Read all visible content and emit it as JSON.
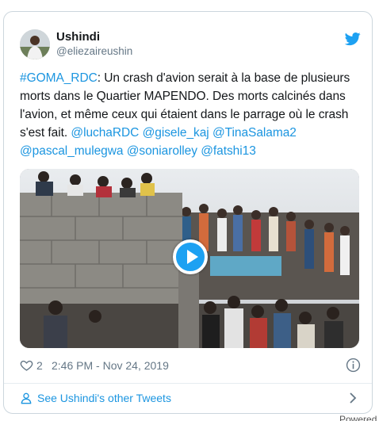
{
  "tweet": {
    "display_name": "Ushindi",
    "handle": "@eliezaireushin",
    "text_parts": [
      {
        "text": "#GOMA_RDC",
        "link": true
      },
      {
        "text": ": Un crash d'avion serait à la base de plusieurs morts dans le Quartier MAPENDO. Des morts calcinés dans l'avion, et même ceux qui étaient dans le parrage où le crash s'est fait. ",
        "link": false
      },
      {
        "text": "@luchaRDC",
        "link": true
      },
      {
        "text": " ",
        "link": false
      },
      {
        "text": "@gisele_kaj",
        "link": true
      },
      {
        "text": " ",
        "link": false
      },
      {
        "text": "@TinaSalama2",
        "link": true
      },
      {
        "text": " ",
        "link": false
      },
      {
        "text": "@pascal_mulegwa",
        "link": true
      },
      {
        "text": " ",
        "link": false
      },
      {
        "text": "@soniarolley",
        "link": true
      },
      {
        "text": " ",
        "link": false
      },
      {
        "text": "@fatshi13",
        "link": true
      }
    ],
    "likes": "2",
    "timestamp": "2:46 PM - Nov 24, 2019",
    "see_more": "See Ushindi's other Tweets"
  },
  "icons": {
    "bird": "twitter-bird-icon",
    "heart": "heart-icon",
    "info": "info-icon",
    "person": "person-icon",
    "chevron": "chevron-right-icon",
    "play": "play-icon"
  },
  "colors": {
    "link": "#1b95e0",
    "brand": "#1da1f2",
    "muted": "#657786",
    "border": "#ccd6dd"
  },
  "page_edge_text": "Powered"
}
